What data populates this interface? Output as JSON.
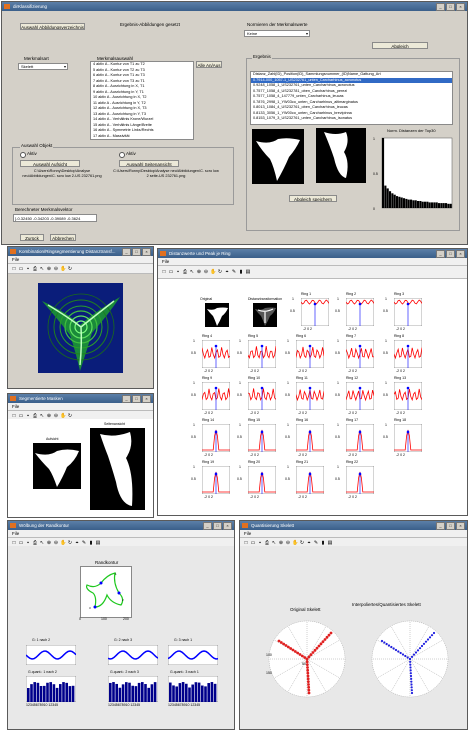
{
  "main": {
    "title": "dirKlassifizierung",
    "btn_select_dir": "Auswahl Abbildungsverzeichnis",
    "status_found": "Ergebnis-Abbildungen gesetzt",
    "merkmalsart_label": "Merkmalsart",
    "merkmalsart_value": "Skelett",
    "merkmalsauswahl_label": "Merkmalsauswahl",
    "merkmals_items": [
      "4 aktiv A - Kontur von T1 zu T2",
      "5 aktiv A - Kontur von T2 zu T3",
      "6 aktiv A - Kontur von T1 zu T3",
      "7 aktiv A - Kontur von T3 zu T1",
      "8 aktiv A - Ausrichtung in X, T1",
      "9 aktiv A - Ausrichtung in Y, T1",
      "10 aktiv A - Ausrichtung in X, T2",
      "11 aktiv A - Ausrichtung in Y, T2",
      "12 aktiv A - Ausrichtung in X, T3",
      "13 aktiv A - Ausrichtung in Y, T3",
      "14 aktiv A - Verhältnis Krone/Wurzel",
      "15 aktiv A - Verhältnis Länge/Breite",
      "16 aktiv A - Symmetrie Links/Rechts",
      "17 aktiv A - Massivität",
      "18 aktiv S - Skelett T1"
    ],
    "btn_alle": "Alle An/Aus",
    "auswahl_objekt_label": "Auswahl Objekt",
    "radio_left": "Aktiv",
    "radio_right": "Aktiv",
    "btn_aufsicht": "Auswahl Aufsicht",
    "btn_seitenansicht": "Auswahl Seitenansicht",
    "path_left": "C:\\Users\\Ronny\\Desktop\\Analyse neu\\Abbildungen\\C. scro low 2-US 232761.png",
    "path_right": "C:\\Users\\Ronny\\Desktop\\Analyse neu\\Abbildungen\\C. scro low 2 seite-US 232761.png",
    "merkmalsvektor_label": "Berechneter Merkmalsvektor",
    "merkmalsvektor_value": "[-0.32450 -0.34203 -0.39089 -0.3624",
    "btn_zurueck": "Zurück",
    "btn_abbrechen": "Abbrechen",
    "normierung_label": "Normieren der Merkmalswerte",
    "normierung_value": "Keine",
    "btn_abgleich": "Abgleich",
    "ergebnis_label": "Ergebnis",
    "ergebnis_header": "Distanz_Zahl(ID)_Position(ID)_Sammlungsnummer_(ID)Name_Gattung_Art",
    "ergebnis_items": [
      "0.7914-000_1057-1_US232761_unten_Carcharhinus_acronotus",
      "0.9248_1058_1_US232761_unten_Carcharhinus_acronotus",
      "0.7577_1058_4_US232781_oben_Carcharhinus_perezi",
      "0.7577_1058_4_147779_unten_Carcharhinus_leucas",
      "0.7876_2998_1_YW03co_unten_Carcharhinus_altimarginatus",
      "0.8013_1084_4_US232761_oben_Carcharhinus_leucas",
      "0.8133_3056_1_YW00co_unten_Carcharhinus_brevipinna",
      "0.8153_1079_3_US232761_unten_Carcharhinus_isonatus"
    ],
    "chart_title": "Norm. Distanzen der Top30",
    "btn_speichern": "Abgleich speichern"
  },
  "chart_data": {
    "type": "bar",
    "title": "Norm. Distanzen der Top30",
    "values": [
      1.0,
      0.32,
      0.28,
      0.24,
      0.21,
      0.19,
      0.17,
      0.16,
      0.15,
      0.14,
      0.13,
      0.12,
      0.12,
      0.11,
      0.11,
      0.1,
      0.1,
      0.09,
      0.09,
      0.09,
      0.08,
      0.08,
      0.08,
      0.08,
      0.07,
      0.07,
      0.07,
      0.07,
      0.06,
      0.06
    ],
    "ylim": [
      0,
      1
    ],
    "yticks": [
      "1",
      "0.5",
      "0"
    ]
  },
  "win_ring": {
    "title": "Kombination/Ringsegmentierung Distanztransf...",
    "menu": "File"
  },
  "win_mask": {
    "title": "Segmentierte Masken",
    "menu": "File",
    "label_left": "Aufsicht",
    "label_right": "Seitenansicht"
  },
  "win_dist": {
    "title": "Distanzwerte und Peak je Ring",
    "menu": "File",
    "label_original": "Original",
    "label_distanz": "Distanztransformation",
    "rings": [
      "Ring 1",
      "Ring 2",
      "Ring 3",
      "Ring 4",
      "Ring 5",
      "Ring 6",
      "Ring 7",
      "Ring 8",
      "Ring 9",
      "Ring 10",
      "Ring 11",
      "Ring 12",
      "Ring 13",
      "Ring 14",
      "Ring 15",
      "Ring 16",
      "Ring 17",
      "Ring 18",
      "Ring 19",
      "Ring 20",
      "Ring 21",
      "Ring 22"
    ],
    "y_tick_top": "1",
    "y_tick_mid": "0.5",
    "x_ticks": "-2 0 2"
  },
  "win_kontur": {
    "title": "Wölbung der Randkontur",
    "menu": "File",
    "plot_title": "Randkontur",
    "x_ticks": [
      "0",
      "100",
      "200"
    ],
    "sub_titles": [
      "G: 1 nach 2",
      "G: 2 nach 3",
      "G: 3 nach 1"
    ],
    "quant_titles": [
      "G.quant.: 1 nach 2",
      "G.quant.: 2 nach 3",
      "G.quant.: 3 nach 1"
    ],
    "quant_x": "12345678910 12345"
  },
  "win_skelett": {
    "title": "Quantisierung Skelett",
    "menu": "File",
    "left_title": "Original Skelett",
    "right_title": "Interpoliertes/Quantisiertes Skelett",
    "radial_ticks": [
      "50",
      "100",
      "150"
    ]
  }
}
